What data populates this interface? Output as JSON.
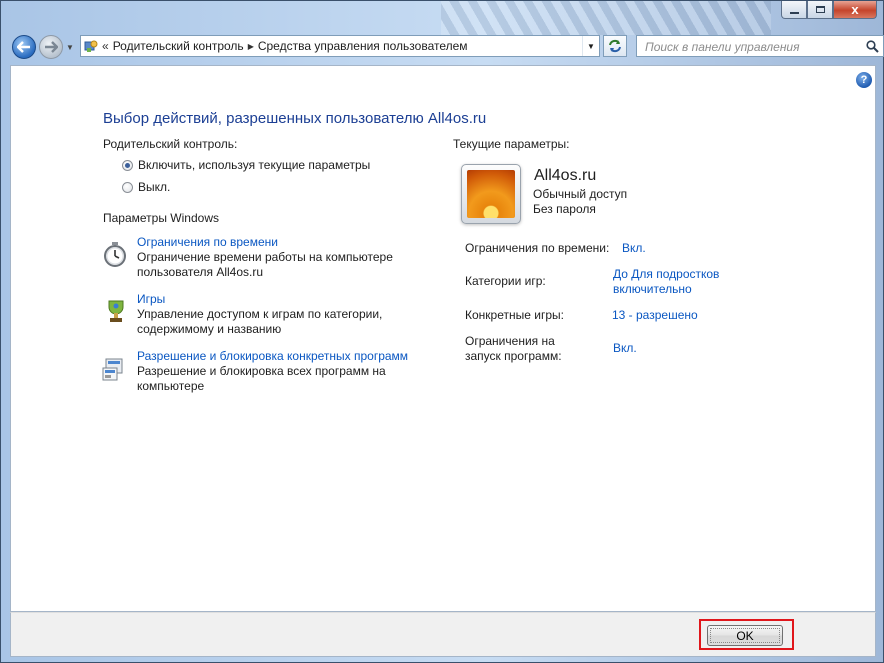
{
  "window": {
    "title_buttons": [
      "minimize",
      "maximize",
      "close"
    ],
    "close_glyph": "x"
  },
  "navbar": {
    "breadcrumb": [
      "Родительский контроль",
      "Средства управления пользователем"
    ],
    "chevron_prefix": "«",
    "separator": "▶",
    "search_placeholder": "Поиск в панели управления"
  },
  "main": {
    "help_glyph": "?",
    "title": "Выбор действий, разрешенных пользователю All4os.ru",
    "parental_control": {
      "label": "Родительский контроль:",
      "options": [
        {
          "label": "Включить, используя текущие параметры",
          "selected": true
        },
        {
          "label": "Выкл.",
          "selected": false
        }
      ]
    },
    "windows_settings": {
      "label": "Параметры Windows",
      "items": [
        {
          "link": "Ограничения по времени",
          "desc": "Ограничение времени работы на компьютере пользователя All4os.ru",
          "icon": "clock-icon"
        },
        {
          "link": "Игры",
          "desc": "Управление доступом к играм по категории, содержимому и названию",
          "icon": "games-trophy-icon"
        },
        {
          "link": "Разрешение и блокировка конкретных программ",
          "desc": "Разрешение и блокировка всех программ на компьютере",
          "icon": "programs-icon"
        }
      ]
    },
    "current": {
      "label": "Текущие параметры:",
      "user_name": "All4os.ru",
      "account_type": "Обычный доступ",
      "password_status": "Без пароля",
      "rows": [
        {
          "key": "Ограничения по времени:",
          "value": "Вкл."
        },
        {
          "key": "Категории игр:",
          "value": "До Для подростков включительно"
        },
        {
          "key": "Конкретные игры:",
          "value": "13 - разрешено"
        },
        {
          "key": "Ограничения на запуск программ:",
          "value": "Вкл."
        }
      ]
    }
  },
  "footer": {
    "ok_label": "OK"
  },
  "colors": {
    "link": "#0a57c2",
    "title": "#1c3f94",
    "highlight": "#e0161b"
  }
}
